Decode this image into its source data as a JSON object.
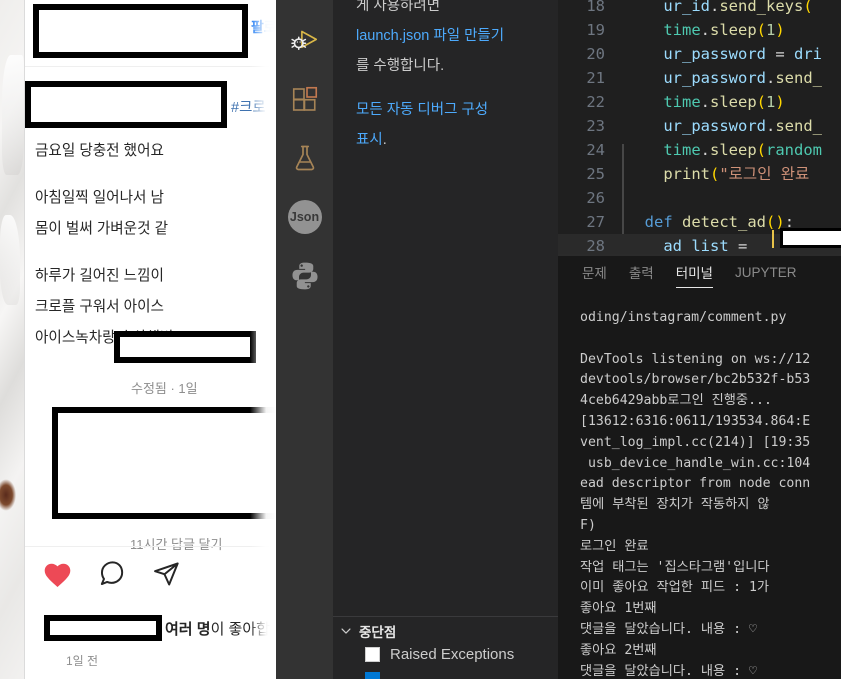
{
  "instagram": {
    "follow_label": "팔로",
    "hashtag": "#크로",
    "caption_lines": [
      "금요일 당충전 했어요",
      "",
      "아침일찍 일어나서 남",
      "몸이 벌써 가벼운것 같",
      "",
      "하루가 길어진 느낌이",
      "크로플 구워서 아이스",
      "아이스녹차랑 순삭해버"
    ],
    "edited_meta": "수정됨 · 1일",
    "comment_meta": "11시간   답글 달기",
    "likes_text": "여러 명이 좋아합",
    "likes_bold": "여러 명",
    "likes_rest": "이 좋아합",
    "post_time": "1일 전",
    "actions": [
      {
        "name": "like-icon",
        "label": "좋아요"
      },
      {
        "name": "comment-icon",
        "label": "댓글"
      },
      {
        "name": "share-icon",
        "label": "공유"
      }
    ],
    "like_color": "#ed4956"
  },
  "activity_bar": {
    "items": [
      {
        "name": "run-and-debug-icon",
        "label": "실행 및 디버그"
      },
      {
        "name": "extensions-icon",
        "label": "확장"
      },
      {
        "name": "testing-flask-icon",
        "label": "테스트"
      },
      {
        "name": "json-icon",
        "label": "Json"
      },
      {
        "name": "python-icon",
        "label": "Python"
      }
    ],
    "json_badge_text": "Json"
  },
  "debug_sidebar": {
    "intro_line_clipped": "게 사용하려면",
    "link1": "launch.json 파일 만들기",
    "intro_tail": "를 수행합니다.",
    "link2_line1": "모든 자동 디버그 구성",
    "link2_line2": "표시",
    "link2_tail": ".",
    "breakpoints_title": "중단점",
    "breakpoints": [
      {
        "label": "Raised Exceptions",
        "checked": false
      },
      {
        "label": "",
        "checked": true
      }
    ]
  },
  "editor": {
    "lines": [
      {
        "num": "18",
        "tokens": [
          {
            "t": "    ",
            "c": "op"
          },
          {
            "t": "ur_id",
            "c": "var"
          },
          {
            "t": ".",
            "c": "op"
          },
          {
            "t": "send_keys",
            "c": "fn"
          },
          {
            "t": "(",
            "c": "par"
          }
        ],
        "clipped": true
      },
      {
        "num": "19",
        "tokens": [
          {
            "t": "    ",
            "c": "op"
          },
          {
            "t": "time",
            "c": "mod"
          },
          {
            "t": ".",
            "c": "op"
          },
          {
            "t": "sleep",
            "c": "fn"
          },
          {
            "t": "(",
            "c": "par"
          },
          {
            "t": "1",
            "c": "num"
          },
          {
            "t": ")",
            "c": "par"
          }
        ]
      },
      {
        "num": "20",
        "tokens": [
          {
            "t": "    ",
            "c": "op"
          },
          {
            "t": "ur_password",
            "c": "var"
          },
          {
            "t": " = ",
            "c": "op"
          },
          {
            "t": "dri",
            "c": "var"
          }
        ]
      },
      {
        "num": "21",
        "tokens": [
          {
            "t": "    ",
            "c": "op"
          },
          {
            "t": "ur_password",
            "c": "var"
          },
          {
            "t": ".",
            "c": "op"
          },
          {
            "t": "send_",
            "c": "fn"
          }
        ]
      },
      {
        "num": "22",
        "tokens": [
          {
            "t": "    ",
            "c": "op"
          },
          {
            "t": "time",
            "c": "mod"
          },
          {
            "t": ".",
            "c": "op"
          },
          {
            "t": "sleep",
            "c": "fn"
          },
          {
            "t": "(",
            "c": "par"
          },
          {
            "t": "1",
            "c": "num"
          },
          {
            "t": ")",
            "c": "par"
          }
        ]
      },
      {
        "num": "23",
        "tokens": [
          {
            "t": "    ",
            "c": "op"
          },
          {
            "t": "ur_password",
            "c": "var"
          },
          {
            "t": ".",
            "c": "op"
          },
          {
            "t": "send_",
            "c": "fn"
          }
        ]
      },
      {
        "num": "24",
        "tokens": [
          {
            "t": "    ",
            "c": "op"
          },
          {
            "t": "time",
            "c": "mod"
          },
          {
            "t": ".",
            "c": "op"
          },
          {
            "t": "sleep",
            "c": "fn"
          },
          {
            "t": "(",
            "c": "par"
          },
          {
            "t": "random",
            "c": "mod"
          }
        ]
      },
      {
        "num": "25",
        "tokens": [
          {
            "t": "    ",
            "c": "op"
          },
          {
            "t": "print",
            "c": "fn"
          },
          {
            "t": "(",
            "c": "par"
          },
          {
            "t": "\"로그인 완료",
            "c": "str"
          }
        ]
      },
      {
        "num": "26",
        "tokens": []
      },
      {
        "num": "27",
        "tokens": [
          {
            "t": "  ",
            "c": "op"
          },
          {
            "t": "def",
            "c": "kw"
          },
          {
            "t": " ",
            "c": "op"
          },
          {
            "t": "detect_ad",
            "c": "fn"
          },
          {
            "t": "(",
            "c": "par"
          },
          {
            "t": ")",
            "c": "par"
          },
          {
            "t": ":",
            "c": "op"
          }
        ]
      },
      {
        "num": "28",
        "tokens": [
          {
            "t": "    ",
            "c": "op"
          },
          {
            "t": "ad_list",
            "c": "var"
          },
          {
            "t": " = ",
            "c": "op"
          }
        ],
        "highlight": true
      }
    ]
  },
  "panel": {
    "tabs": [
      {
        "label": "문제",
        "active": false
      },
      {
        "label": "출력",
        "active": false
      },
      {
        "label": "터미널",
        "active": true
      },
      {
        "label": "JUPYTER",
        "active": false
      }
    ],
    "terminal_lines": [
      "oding/instagram/comment.py",
      "",
      "DevTools listening on ws://12",
      "devtools/browser/bc2b532f-b53",
      "4ceb6429abb로그인 진행중...",
      "[13612:6316:0611/193534.864:E",
      "vent_log_impl.cc(214)] [19:35",
      " usb_device_handle_win.cc:104",
      "ead descriptor from node conn",
      "템에 부착된 장치가 작동하지 않",
      "F)",
      "로그인 완료",
      "작업 태그는 '집스타그램'입니다",
      "이미 좋아요 작업한 피드 : 1가",
      "좋아요 1번째",
      "댓글을 달았습니다. 내용 : ♡",
      "좋아요 2번째",
      "댓글을 달았습니다. 내용 : ♡"
    ]
  }
}
